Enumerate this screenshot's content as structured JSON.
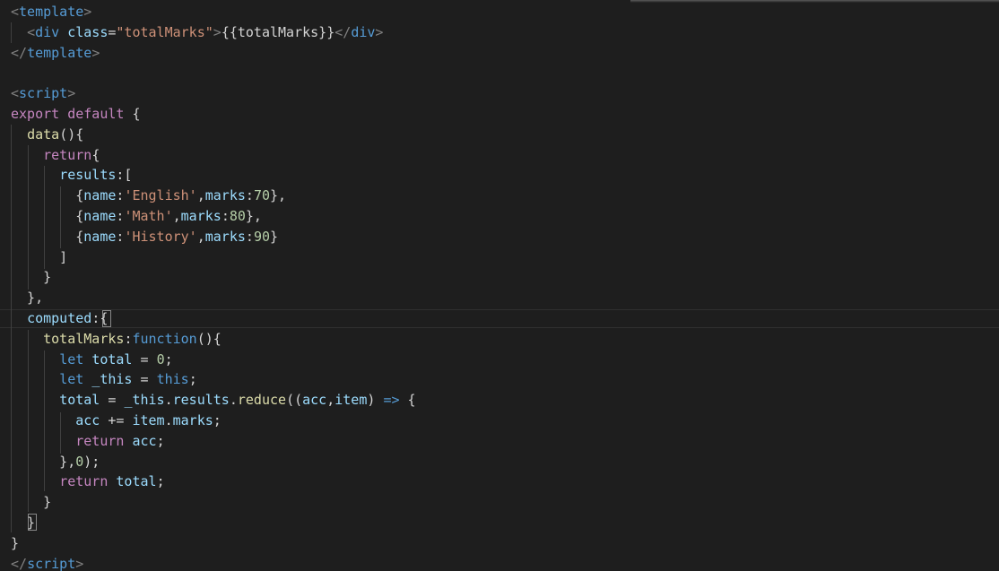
{
  "editor": {
    "lines": [
      [
        {
          "t": "<",
          "c": "t-punc"
        },
        {
          "t": "template",
          "c": "t-tag"
        },
        {
          "t": ">",
          "c": "t-punc"
        }
      ],
      [
        {
          "t": "  "
        },
        {
          "t": "<",
          "c": "t-punc"
        },
        {
          "t": "div",
          "c": "t-tag"
        },
        {
          "t": " "
        },
        {
          "t": "class",
          "c": "t-attr"
        },
        {
          "t": "=",
          "c": "t-text"
        },
        {
          "t": "\"totalMarks\"",
          "c": "t-str"
        },
        {
          "t": ">",
          "c": "t-punc"
        },
        {
          "t": "{{totalMarks}}",
          "c": "t-text"
        },
        {
          "t": "</",
          "c": "t-punc"
        },
        {
          "t": "div",
          "c": "t-tag"
        },
        {
          "t": ">",
          "c": "t-punc"
        }
      ],
      [
        {
          "t": "</",
          "c": "t-punc"
        },
        {
          "t": "template",
          "c": "t-tag"
        },
        {
          "t": ">",
          "c": "t-punc"
        }
      ],
      [],
      [
        {
          "t": "<",
          "c": "t-punc"
        },
        {
          "t": "script",
          "c": "t-tag"
        },
        {
          "t": ">",
          "c": "t-punc"
        }
      ],
      [
        {
          "t": "export",
          "c": "t-kw"
        },
        {
          "t": " "
        },
        {
          "t": "default",
          "c": "t-kw"
        },
        {
          "t": " {",
          "c": "t-text"
        }
      ],
      [
        {
          "t": "  "
        },
        {
          "t": "data",
          "c": "t-fn"
        },
        {
          "t": "(){",
          "c": "t-text"
        }
      ],
      [
        {
          "t": "    "
        },
        {
          "t": "return",
          "c": "t-kw"
        },
        {
          "t": "{",
          "c": "t-text"
        }
      ],
      [
        {
          "t": "      "
        },
        {
          "t": "results",
          "c": "t-prop"
        },
        {
          "t": ":[",
          "c": "t-text"
        }
      ],
      [
        {
          "t": "        {",
          "c": "t-text"
        },
        {
          "t": "name",
          "c": "t-prop"
        },
        {
          "t": ":",
          "c": "t-text"
        },
        {
          "t": "'English'",
          "c": "t-str"
        },
        {
          "t": ",",
          "c": "t-text"
        },
        {
          "t": "marks",
          "c": "t-prop"
        },
        {
          "t": ":",
          "c": "t-text"
        },
        {
          "t": "70",
          "c": "t-num"
        },
        {
          "t": "},",
          "c": "t-text"
        }
      ],
      [
        {
          "t": "        {",
          "c": "t-text"
        },
        {
          "t": "name",
          "c": "t-prop"
        },
        {
          "t": ":",
          "c": "t-text"
        },
        {
          "t": "'Math'",
          "c": "t-str"
        },
        {
          "t": ",",
          "c": "t-text"
        },
        {
          "t": "marks",
          "c": "t-prop"
        },
        {
          "t": ":",
          "c": "t-text"
        },
        {
          "t": "80",
          "c": "t-num"
        },
        {
          "t": "},",
          "c": "t-text"
        }
      ],
      [
        {
          "t": "        {",
          "c": "t-text"
        },
        {
          "t": "name",
          "c": "t-prop"
        },
        {
          "t": ":",
          "c": "t-text"
        },
        {
          "t": "'History'",
          "c": "t-str"
        },
        {
          "t": ",",
          "c": "t-text"
        },
        {
          "t": "marks",
          "c": "t-prop"
        },
        {
          "t": ":",
          "c": "t-text"
        },
        {
          "t": "90",
          "c": "t-num"
        },
        {
          "t": "}",
          "c": "t-text"
        }
      ],
      [
        {
          "t": "      ]",
          "c": "t-text"
        }
      ],
      [
        {
          "t": "    }",
          "c": "t-text"
        }
      ],
      [
        {
          "t": "  },",
          "c": "t-text"
        }
      ],
      [
        {
          "t": "  "
        },
        {
          "t": "computed",
          "c": "t-prop"
        },
        {
          "t": ":{",
          "c": "t-text"
        }
      ],
      [
        {
          "t": "    "
        },
        {
          "t": "totalMarks",
          "c": "t-fn"
        },
        {
          "t": ":",
          "c": "t-text"
        },
        {
          "t": "function",
          "c": "t-blue"
        },
        {
          "t": "(){",
          "c": "t-text"
        }
      ],
      [
        {
          "t": "      "
        },
        {
          "t": "let",
          "c": "t-blue"
        },
        {
          "t": " "
        },
        {
          "t": "total",
          "c": "t-prop"
        },
        {
          "t": " = ",
          "c": "t-text"
        },
        {
          "t": "0",
          "c": "t-num"
        },
        {
          "t": ";",
          "c": "t-text"
        }
      ],
      [
        {
          "t": "      "
        },
        {
          "t": "let",
          "c": "t-blue"
        },
        {
          "t": " "
        },
        {
          "t": "_this",
          "c": "t-prop"
        },
        {
          "t": " = ",
          "c": "t-text"
        },
        {
          "t": "this",
          "c": "t-blue"
        },
        {
          "t": ";",
          "c": "t-text"
        }
      ],
      [
        {
          "t": "      "
        },
        {
          "t": "total",
          "c": "t-prop"
        },
        {
          "t": " = ",
          "c": "t-text"
        },
        {
          "t": "_this",
          "c": "t-prop"
        },
        {
          "t": ".",
          "c": "t-text"
        },
        {
          "t": "results",
          "c": "t-prop"
        },
        {
          "t": ".",
          "c": "t-text"
        },
        {
          "t": "reduce",
          "c": "t-fn"
        },
        {
          "t": "((",
          "c": "t-text"
        },
        {
          "t": "acc",
          "c": "t-prop"
        },
        {
          "t": ",",
          "c": "t-text"
        },
        {
          "t": "item",
          "c": "t-prop"
        },
        {
          "t": ") ",
          "c": "t-text"
        },
        {
          "t": "=>",
          "c": "t-blue"
        },
        {
          "t": " {",
          "c": "t-text"
        }
      ],
      [
        {
          "t": "        "
        },
        {
          "t": "acc",
          "c": "t-prop"
        },
        {
          "t": " += ",
          "c": "t-text"
        },
        {
          "t": "item",
          "c": "t-prop"
        },
        {
          "t": ".",
          "c": "t-text"
        },
        {
          "t": "marks",
          "c": "t-prop"
        },
        {
          "t": ";",
          "c": "t-text"
        }
      ],
      [
        {
          "t": "        "
        },
        {
          "t": "return",
          "c": "t-kw"
        },
        {
          "t": " "
        },
        {
          "t": "acc",
          "c": "t-prop"
        },
        {
          "t": ";",
          "c": "t-text"
        }
      ],
      [
        {
          "t": "      },",
          "c": "t-text"
        },
        {
          "t": "0",
          "c": "t-num"
        },
        {
          "t": ");",
          "c": "t-text"
        }
      ],
      [
        {
          "t": "      "
        },
        {
          "t": "return",
          "c": "t-kw"
        },
        {
          "t": " "
        },
        {
          "t": "total",
          "c": "t-prop"
        },
        {
          "t": ";",
          "c": "t-text"
        }
      ],
      [
        {
          "t": "    }",
          "c": "t-text"
        }
      ],
      [
        {
          "t": "  }",
          "c": "t-text"
        }
      ],
      [
        {
          "t": "}",
          "c": "t-text"
        }
      ],
      [
        {
          "t": "</",
          "c": "t-punc"
        },
        {
          "t": "script",
          "c": "t-tag"
        },
        {
          "t": ">",
          "c": "t-punc"
        }
      ]
    ]
  },
  "colors": {
    "background": "#1e1e1e",
    "tag": "#569cd6",
    "keyword": "#c586c0",
    "function": "#dcdcaa",
    "property": "#9cdcfe",
    "string": "#ce9178",
    "number": "#b5cea8"
  }
}
